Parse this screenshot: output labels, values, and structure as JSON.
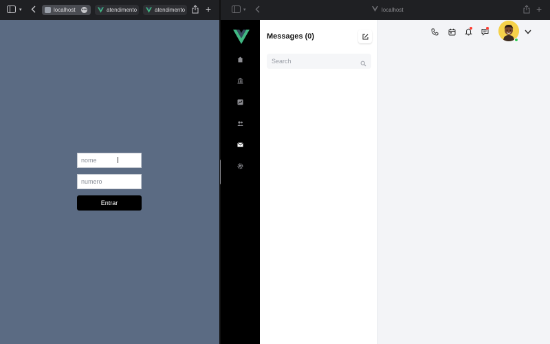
{
  "left_window": {
    "tabs": [
      {
        "label": "localhost",
        "active": true
      },
      {
        "label": "atendimento",
        "active": false
      },
      {
        "label": "atendimento",
        "active": false
      }
    ],
    "form": {
      "name_placeholder": "nome",
      "number_placeholder": "numero",
      "submit_label": "Entrar"
    }
  },
  "right_window": {
    "url": "localhost",
    "sidebar": {
      "items": [
        {
          "icon": "home-icon"
        },
        {
          "icon": "bank-icon"
        },
        {
          "icon": "report-icon"
        },
        {
          "icon": "users-icon"
        },
        {
          "icon": "mail-icon",
          "active": true
        },
        {
          "icon": "gear-icon"
        }
      ]
    },
    "messages": {
      "title": "Messages (0)",
      "search_placeholder": "Search"
    },
    "header_icons": [
      "phone-icon",
      "calendar-icon",
      "bell-icon",
      "chat-icon"
    ]
  },
  "colors": {
    "vue_green": "#41b883",
    "vue_dark": "#35495e",
    "left_bg": "#5b6b83",
    "sidebar_bg": "#000000",
    "online": "#34c759",
    "notify": "#ff3b30"
  }
}
